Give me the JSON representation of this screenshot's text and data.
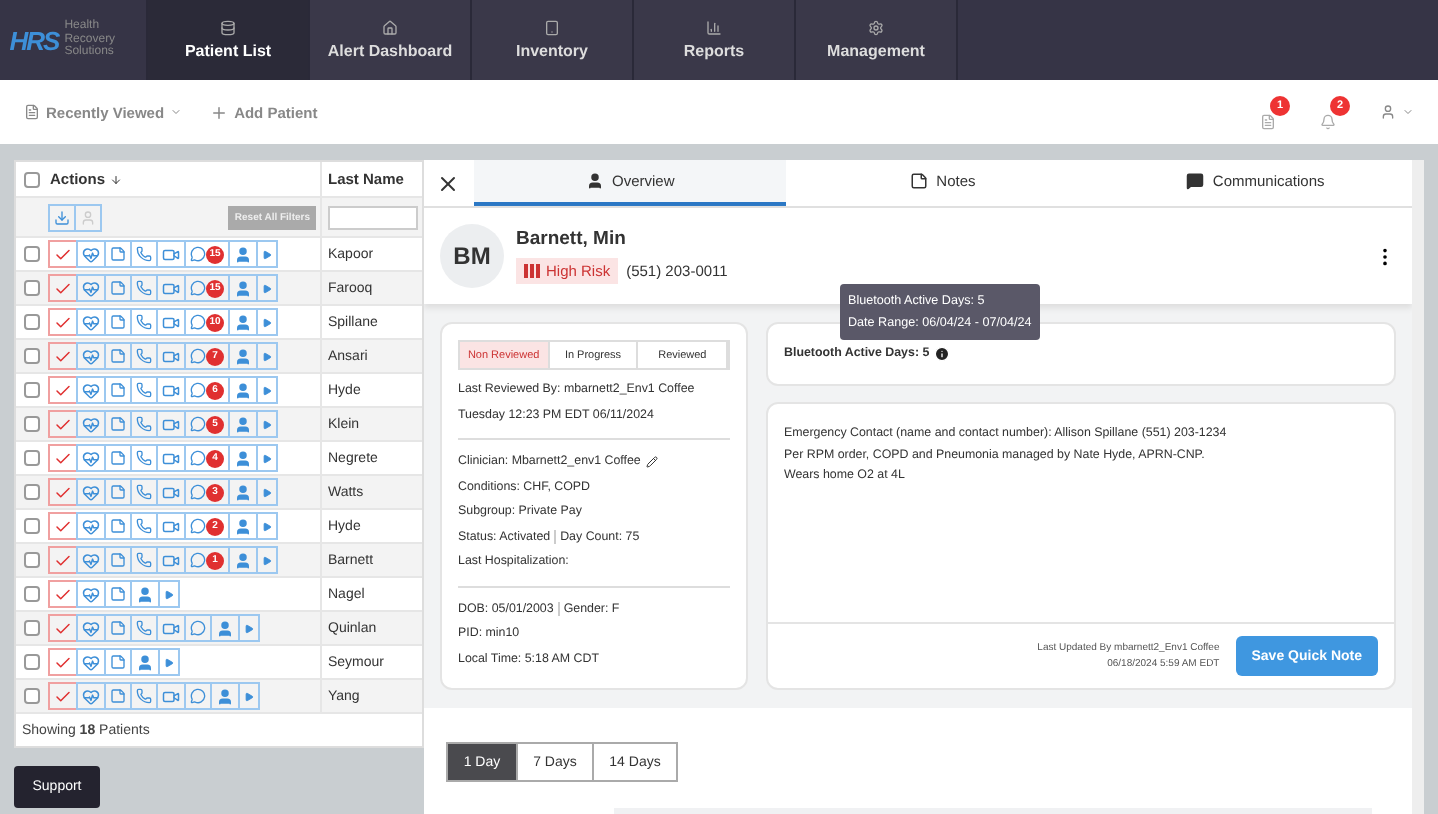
{
  "nav": {
    "logo": "HRS",
    "logo_tagline": "Health Recovery Solutions",
    "items": [
      {
        "label": "Patient List",
        "selected": true
      },
      {
        "label": "Alert Dashboard",
        "selected": false
      },
      {
        "label": "Inventory",
        "selected": false
      },
      {
        "label": "Reports",
        "selected": false
      },
      {
        "label": "Management",
        "selected": false
      }
    ]
  },
  "toolbar": {
    "recently_viewed": "Recently Viewed",
    "add_patient": "Add Patient",
    "notifications": [
      "1",
      "2"
    ]
  },
  "patient_table": {
    "select_all": false,
    "columns": [
      "Actions",
      "Last Name"
    ],
    "reset_filters": "Reset All Filters",
    "rows": [
      {
        "last_name": "Kapoor",
        "checked": false,
        "kind": "full",
        "badge": "15"
      },
      {
        "last_name": "Farooq",
        "checked": false,
        "kind": "full",
        "badge": "15"
      },
      {
        "last_name": "Spillane",
        "checked": false,
        "kind": "full",
        "badge": "10"
      },
      {
        "last_name": "Ansari",
        "checked": false,
        "kind": "full",
        "badge": "7"
      },
      {
        "last_name": "Hyde",
        "checked": false,
        "kind": "full",
        "badge": "6"
      },
      {
        "last_name": "Klein",
        "checked": false,
        "kind": "full",
        "badge": "5"
      },
      {
        "last_name": "Negrete",
        "checked": false,
        "kind": "full",
        "badge": "4"
      },
      {
        "last_name": "Watts",
        "checked": false,
        "kind": "full",
        "badge": "3"
      },
      {
        "last_name": "Hyde",
        "checked": false,
        "kind": "full",
        "badge": "2"
      },
      {
        "last_name": "Barnett",
        "checked": false,
        "kind": "full",
        "badge": "1"
      },
      {
        "last_name": "Nagel",
        "checked": false,
        "kind": "short"
      },
      {
        "last_name": "Quinlan",
        "checked": false,
        "kind": "full"
      },
      {
        "last_name": "Seymour",
        "checked": false,
        "kind": "short"
      },
      {
        "last_name": "Yang",
        "checked": false,
        "kind": "full"
      }
    ],
    "footer": "Showing **18** Patients"
  },
  "support_button": "Support",
  "detail": {
    "tabs": [
      {
        "label": "Overview",
        "selected": true
      },
      {
        "label": "Notes",
        "selected": false
      },
      {
        "label": "Communications",
        "selected": false
      }
    ],
    "patient": {
      "initials": "BM",
      "name": "Barnett, Min",
      "risk": "High Risk",
      "phone": "(551) 203-0011"
    },
    "tooltip": [
      "Bluetooth Active Days: 5",
      "Date Range: 06/04/24 - 07/04/24"
    ],
    "review_status": [
      {
        "label": "Non Reviewed",
        "selected": true
      },
      {
        "label": "In Progress",
        "selected": false
      },
      {
        "label": "Reviewed",
        "selected": false
      }
    ],
    "last_reviewed": [
      "Last Reviewed By: mbarnett2_Env1 Coffee",
      "Tuesday 12:23 PM EDT 06/11/2024"
    ],
    "clinician": "Clinician: Mbarnett2_env1 Coffee",
    "info": [
      [
        "Conditions: CHF, COPD"
      ],
      [
        "Subgroup: Private Pay"
      ],
      [
        "Status: Activated",
        "Day Count: 75"
      ],
      [
        "Last Hospitalization:"
      ]
    ],
    "demographics": [
      [
        "DOB: 05/01/2003",
        "Gender: F"
      ],
      [
        "PID: min10"
      ],
      [
        "Local Time: 5:18 AM CDT"
      ]
    ],
    "bluetooth": "Bluetooth Active Days: 5",
    "quick_note": [
      "Emergency Contact (name and contact number): Allison Spillane (551) 203-1234",
      "Per RPM order, COPD and Pneumonia managed by Nate Hyde, APRN-CNP.",
      "Wears home O2 at 4L"
    ],
    "last_updated": [
      "Last Updated By mbarnett2_Env1 Coffee",
      "06/18/2024 5:59 AM EDT"
    ],
    "save_button": "Save Quick Note",
    "ranges": [
      {
        "label": "1 Day",
        "selected": true
      },
      {
        "label": "7 Days",
        "selected": false
      },
      {
        "label": "14 Days",
        "selected": false
      }
    ]
  }
}
